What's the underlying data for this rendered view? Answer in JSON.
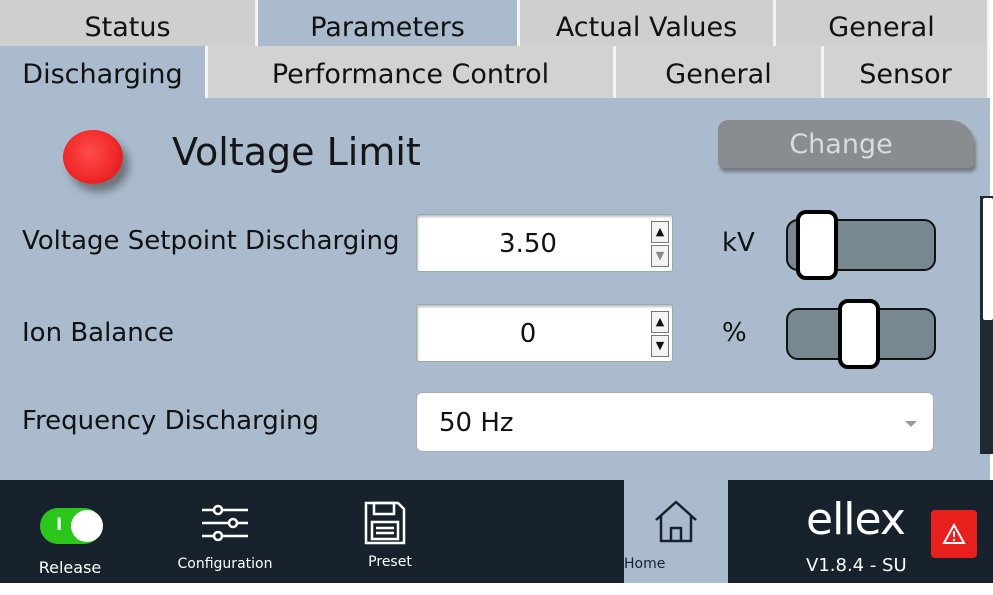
{
  "tabs_top": [
    {
      "label": "Status",
      "active": false
    },
    {
      "label": "Parameters",
      "active": true
    },
    {
      "label": "Actual Values",
      "active": false
    },
    {
      "label": "General",
      "active": false
    }
  ],
  "tabs_sub": [
    {
      "label": "Discharging",
      "active": true
    },
    {
      "label": "Performance Control",
      "active": false
    },
    {
      "label": "General",
      "active": false
    },
    {
      "label": "Sensor",
      "active": false
    }
  ],
  "section": {
    "title": "Voltage Limit",
    "indicator_icon": "status-led-icon",
    "indicator_color": "#f12a2a",
    "change_label": "Change"
  },
  "fields": {
    "voltage": {
      "label": "Voltage Setpoint Discharging",
      "value": "3.50",
      "unit": "kV",
      "slider_fraction": 0.1
    },
    "ion_balance": {
      "label": "Ion Balance",
      "value": "0",
      "unit": "%",
      "slider_fraction": 0.5
    },
    "frequency": {
      "label": "Frequency Discharging",
      "selected": "50 Hz"
    }
  },
  "footer": {
    "release_label": "Release",
    "release_toggle_mark": "I",
    "release_state": "on",
    "configuration_label": "Configuration",
    "preset_label": "Preset",
    "home_label": "Home",
    "brand": "ellex",
    "version": "V1.8.4 - SU",
    "alarm_icon": "warning-triangle-icon"
  },
  "colors": {
    "panel": "#a9bbcd",
    "footer": "#18222d",
    "tab_inactive": "#cfcfcf",
    "toggle_on": "#2bc51b",
    "alarm": "#e8201d"
  }
}
